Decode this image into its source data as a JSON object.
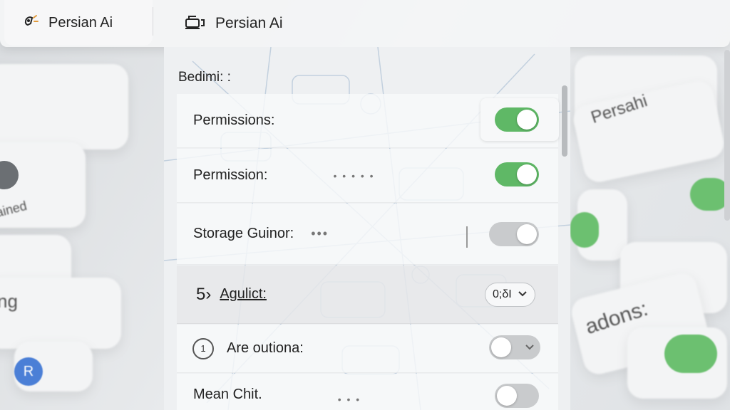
{
  "tabs": {
    "left_title": "Persian Ai",
    "right_title": "Persian Ai",
    "left_icon": "brain-sparkle-icon",
    "right_icon": "robot-icon"
  },
  "settings": {
    "section_title": "Bedimi: :",
    "rows": [
      {
        "label": "Permissions:",
        "control": "toggle",
        "state": "on"
      },
      {
        "label": "Permission:",
        "dots": "• • • • •",
        "control": "toggle",
        "state": "on"
      },
      {
        "label": "Storage Guinor:",
        "dots": "•••",
        "control": "toggle",
        "state": "off"
      },
      {
        "prefix": "5›",
        "label": "Agulict:",
        "control": "select",
        "value": "0;δI"
      },
      {
        "label": "Are outiona:",
        "control": "toggle",
        "state": "off"
      },
      {
        "label": "Mean Chit.",
        "dots": "• • •",
        "control": "toggle",
        "state": "off"
      }
    ]
  },
  "background": {
    "labels": [
      "Persahi",
      "adons:",
      "ng",
      "ained"
    ],
    "avatar_letter": "R"
  },
  "colors": {
    "toggle_on": "#5fb866",
    "toggle_off": "#c9cbcd",
    "panel_bg": "#eef0f2"
  }
}
